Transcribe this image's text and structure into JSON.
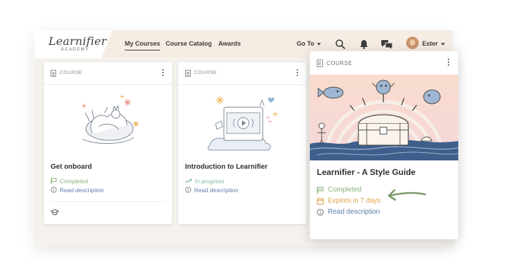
{
  "brand": {
    "logo_text": "Learnifier",
    "logo_sub": "ACADEMY"
  },
  "nav": {
    "my_courses": "My Courses",
    "course_catalog": "Course Catalog",
    "awards": "Awards",
    "go_to": "Go To"
  },
  "user": {
    "name": "Ester"
  },
  "cards": [
    {
      "tag": "COURSE",
      "title": "Get onboard",
      "status": "Completed",
      "link": "Read description"
    },
    {
      "tag": "COURSE",
      "title": "Introduction to Learnifier",
      "status": "In progress",
      "link": "Read description"
    }
  ],
  "featured": {
    "tag": "COURSE",
    "title": "Learnifier - A Style Guide",
    "status": "Completed",
    "expiry": "Expires in 7 days",
    "link": "Read description"
  },
  "colors": {
    "topbar": "#f5ece4",
    "completed_green": "#86b27a",
    "progress_green": "#7fb89a",
    "expires_orange": "#e0a24a",
    "link_blue": "#5d7aa8",
    "arrow_green": "#7a9a6e"
  }
}
